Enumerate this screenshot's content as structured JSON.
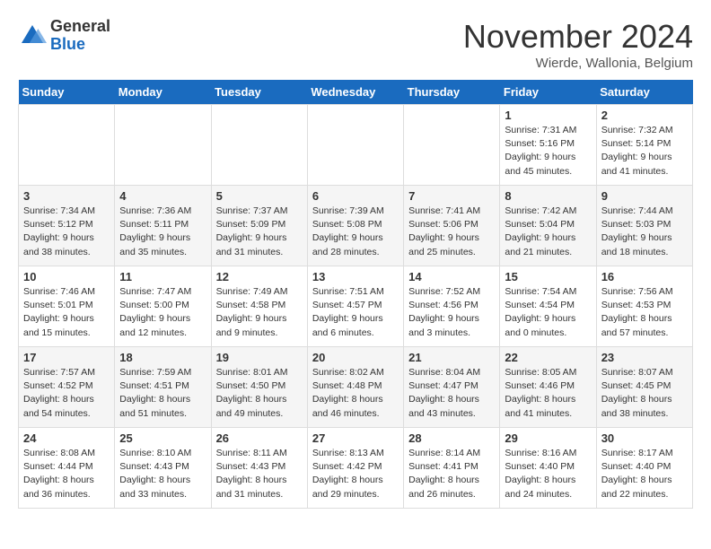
{
  "logo": {
    "general": "General",
    "blue": "Blue"
  },
  "title": "November 2024",
  "location": "Wierde, Wallonia, Belgium",
  "days_of_week": [
    "Sunday",
    "Monday",
    "Tuesday",
    "Wednesday",
    "Thursday",
    "Friday",
    "Saturday"
  ],
  "weeks": [
    [
      {
        "day": "",
        "info": ""
      },
      {
        "day": "",
        "info": ""
      },
      {
        "day": "",
        "info": ""
      },
      {
        "day": "",
        "info": ""
      },
      {
        "day": "",
        "info": ""
      },
      {
        "day": "1",
        "info": "Sunrise: 7:31 AM\nSunset: 5:16 PM\nDaylight: 9 hours\nand 45 minutes."
      },
      {
        "day": "2",
        "info": "Sunrise: 7:32 AM\nSunset: 5:14 PM\nDaylight: 9 hours\nand 41 minutes."
      }
    ],
    [
      {
        "day": "3",
        "info": "Sunrise: 7:34 AM\nSunset: 5:12 PM\nDaylight: 9 hours\nand 38 minutes."
      },
      {
        "day": "4",
        "info": "Sunrise: 7:36 AM\nSunset: 5:11 PM\nDaylight: 9 hours\nand 35 minutes."
      },
      {
        "day": "5",
        "info": "Sunrise: 7:37 AM\nSunset: 5:09 PM\nDaylight: 9 hours\nand 31 minutes."
      },
      {
        "day": "6",
        "info": "Sunrise: 7:39 AM\nSunset: 5:08 PM\nDaylight: 9 hours\nand 28 minutes."
      },
      {
        "day": "7",
        "info": "Sunrise: 7:41 AM\nSunset: 5:06 PM\nDaylight: 9 hours\nand 25 minutes."
      },
      {
        "day": "8",
        "info": "Sunrise: 7:42 AM\nSunset: 5:04 PM\nDaylight: 9 hours\nand 21 minutes."
      },
      {
        "day": "9",
        "info": "Sunrise: 7:44 AM\nSunset: 5:03 PM\nDaylight: 9 hours\nand 18 minutes."
      }
    ],
    [
      {
        "day": "10",
        "info": "Sunrise: 7:46 AM\nSunset: 5:01 PM\nDaylight: 9 hours\nand 15 minutes."
      },
      {
        "day": "11",
        "info": "Sunrise: 7:47 AM\nSunset: 5:00 PM\nDaylight: 9 hours\nand 12 minutes."
      },
      {
        "day": "12",
        "info": "Sunrise: 7:49 AM\nSunset: 4:58 PM\nDaylight: 9 hours\nand 9 minutes."
      },
      {
        "day": "13",
        "info": "Sunrise: 7:51 AM\nSunset: 4:57 PM\nDaylight: 9 hours\nand 6 minutes."
      },
      {
        "day": "14",
        "info": "Sunrise: 7:52 AM\nSunset: 4:56 PM\nDaylight: 9 hours\nand 3 minutes."
      },
      {
        "day": "15",
        "info": "Sunrise: 7:54 AM\nSunset: 4:54 PM\nDaylight: 9 hours\nand 0 minutes."
      },
      {
        "day": "16",
        "info": "Sunrise: 7:56 AM\nSunset: 4:53 PM\nDaylight: 8 hours\nand 57 minutes."
      }
    ],
    [
      {
        "day": "17",
        "info": "Sunrise: 7:57 AM\nSunset: 4:52 PM\nDaylight: 8 hours\nand 54 minutes."
      },
      {
        "day": "18",
        "info": "Sunrise: 7:59 AM\nSunset: 4:51 PM\nDaylight: 8 hours\nand 51 minutes."
      },
      {
        "day": "19",
        "info": "Sunrise: 8:01 AM\nSunset: 4:50 PM\nDaylight: 8 hours\nand 49 minutes."
      },
      {
        "day": "20",
        "info": "Sunrise: 8:02 AM\nSunset: 4:48 PM\nDaylight: 8 hours\nand 46 minutes."
      },
      {
        "day": "21",
        "info": "Sunrise: 8:04 AM\nSunset: 4:47 PM\nDaylight: 8 hours\nand 43 minutes."
      },
      {
        "day": "22",
        "info": "Sunrise: 8:05 AM\nSunset: 4:46 PM\nDaylight: 8 hours\nand 41 minutes."
      },
      {
        "day": "23",
        "info": "Sunrise: 8:07 AM\nSunset: 4:45 PM\nDaylight: 8 hours\nand 38 minutes."
      }
    ],
    [
      {
        "day": "24",
        "info": "Sunrise: 8:08 AM\nSunset: 4:44 PM\nDaylight: 8 hours\nand 36 minutes."
      },
      {
        "day": "25",
        "info": "Sunrise: 8:10 AM\nSunset: 4:43 PM\nDaylight: 8 hours\nand 33 minutes."
      },
      {
        "day": "26",
        "info": "Sunrise: 8:11 AM\nSunset: 4:43 PM\nDaylight: 8 hours\nand 31 minutes."
      },
      {
        "day": "27",
        "info": "Sunrise: 8:13 AM\nSunset: 4:42 PM\nDaylight: 8 hours\nand 29 minutes."
      },
      {
        "day": "28",
        "info": "Sunrise: 8:14 AM\nSunset: 4:41 PM\nDaylight: 8 hours\nand 26 minutes."
      },
      {
        "day": "29",
        "info": "Sunrise: 8:16 AM\nSunset: 4:40 PM\nDaylight: 8 hours\nand 24 minutes."
      },
      {
        "day": "30",
        "info": "Sunrise: 8:17 AM\nSunset: 4:40 PM\nDaylight: 8 hours\nand 22 minutes."
      }
    ]
  ]
}
